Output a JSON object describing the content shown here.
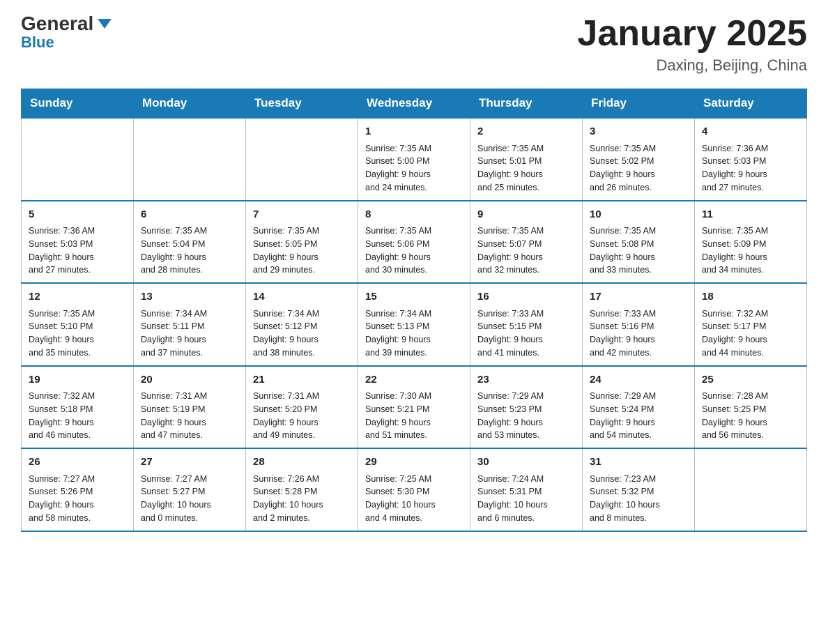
{
  "header": {
    "logo_general": "General",
    "logo_blue": "Blue",
    "month_title": "January 2025",
    "location": "Daxing, Beijing, China"
  },
  "days_of_week": [
    "Sunday",
    "Monday",
    "Tuesday",
    "Wednesday",
    "Thursday",
    "Friday",
    "Saturday"
  ],
  "weeks": [
    [
      {
        "day": "",
        "info": ""
      },
      {
        "day": "",
        "info": ""
      },
      {
        "day": "",
        "info": ""
      },
      {
        "day": "1",
        "info": "Sunrise: 7:35 AM\nSunset: 5:00 PM\nDaylight: 9 hours\nand 24 minutes."
      },
      {
        "day": "2",
        "info": "Sunrise: 7:35 AM\nSunset: 5:01 PM\nDaylight: 9 hours\nand 25 minutes."
      },
      {
        "day": "3",
        "info": "Sunrise: 7:35 AM\nSunset: 5:02 PM\nDaylight: 9 hours\nand 26 minutes."
      },
      {
        "day": "4",
        "info": "Sunrise: 7:36 AM\nSunset: 5:03 PM\nDaylight: 9 hours\nand 27 minutes."
      }
    ],
    [
      {
        "day": "5",
        "info": "Sunrise: 7:36 AM\nSunset: 5:03 PM\nDaylight: 9 hours\nand 27 minutes."
      },
      {
        "day": "6",
        "info": "Sunrise: 7:35 AM\nSunset: 5:04 PM\nDaylight: 9 hours\nand 28 minutes."
      },
      {
        "day": "7",
        "info": "Sunrise: 7:35 AM\nSunset: 5:05 PM\nDaylight: 9 hours\nand 29 minutes."
      },
      {
        "day": "8",
        "info": "Sunrise: 7:35 AM\nSunset: 5:06 PM\nDaylight: 9 hours\nand 30 minutes."
      },
      {
        "day": "9",
        "info": "Sunrise: 7:35 AM\nSunset: 5:07 PM\nDaylight: 9 hours\nand 32 minutes."
      },
      {
        "day": "10",
        "info": "Sunrise: 7:35 AM\nSunset: 5:08 PM\nDaylight: 9 hours\nand 33 minutes."
      },
      {
        "day": "11",
        "info": "Sunrise: 7:35 AM\nSunset: 5:09 PM\nDaylight: 9 hours\nand 34 minutes."
      }
    ],
    [
      {
        "day": "12",
        "info": "Sunrise: 7:35 AM\nSunset: 5:10 PM\nDaylight: 9 hours\nand 35 minutes."
      },
      {
        "day": "13",
        "info": "Sunrise: 7:34 AM\nSunset: 5:11 PM\nDaylight: 9 hours\nand 37 minutes."
      },
      {
        "day": "14",
        "info": "Sunrise: 7:34 AM\nSunset: 5:12 PM\nDaylight: 9 hours\nand 38 minutes."
      },
      {
        "day": "15",
        "info": "Sunrise: 7:34 AM\nSunset: 5:13 PM\nDaylight: 9 hours\nand 39 minutes."
      },
      {
        "day": "16",
        "info": "Sunrise: 7:33 AM\nSunset: 5:15 PM\nDaylight: 9 hours\nand 41 minutes."
      },
      {
        "day": "17",
        "info": "Sunrise: 7:33 AM\nSunset: 5:16 PM\nDaylight: 9 hours\nand 42 minutes."
      },
      {
        "day": "18",
        "info": "Sunrise: 7:32 AM\nSunset: 5:17 PM\nDaylight: 9 hours\nand 44 minutes."
      }
    ],
    [
      {
        "day": "19",
        "info": "Sunrise: 7:32 AM\nSunset: 5:18 PM\nDaylight: 9 hours\nand 46 minutes."
      },
      {
        "day": "20",
        "info": "Sunrise: 7:31 AM\nSunset: 5:19 PM\nDaylight: 9 hours\nand 47 minutes."
      },
      {
        "day": "21",
        "info": "Sunrise: 7:31 AM\nSunset: 5:20 PM\nDaylight: 9 hours\nand 49 minutes."
      },
      {
        "day": "22",
        "info": "Sunrise: 7:30 AM\nSunset: 5:21 PM\nDaylight: 9 hours\nand 51 minutes."
      },
      {
        "day": "23",
        "info": "Sunrise: 7:29 AM\nSunset: 5:23 PM\nDaylight: 9 hours\nand 53 minutes."
      },
      {
        "day": "24",
        "info": "Sunrise: 7:29 AM\nSunset: 5:24 PM\nDaylight: 9 hours\nand 54 minutes."
      },
      {
        "day": "25",
        "info": "Sunrise: 7:28 AM\nSunset: 5:25 PM\nDaylight: 9 hours\nand 56 minutes."
      }
    ],
    [
      {
        "day": "26",
        "info": "Sunrise: 7:27 AM\nSunset: 5:26 PM\nDaylight: 9 hours\nand 58 minutes."
      },
      {
        "day": "27",
        "info": "Sunrise: 7:27 AM\nSunset: 5:27 PM\nDaylight: 10 hours\nand 0 minutes."
      },
      {
        "day": "28",
        "info": "Sunrise: 7:26 AM\nSunset: 5:28 PM\nDaylight: 10 hours\nand 2 minutes."
      },
      {
        "day": "29",
        "info": "Sunrise: 7:25 AM\nSunset: 5:30 PM\nDaylight: 10 hours\nand 4 minutes."
      },
      {
        "day": "30",
        "info": "Sunrise: 7:24 AM\nSunset: 5:31 PM\nDaylight: 10 hours\nand 6 minutes."
      },
      {
        "day": "31",
        "info": "Sunrise: 7:23 AM\nSunset: 5:32 PM\nDaylight: 10 hours\nand 8 minutes."
      },
      {
        "day": "",
        "info": ""
      }
    ]
  ]
}
